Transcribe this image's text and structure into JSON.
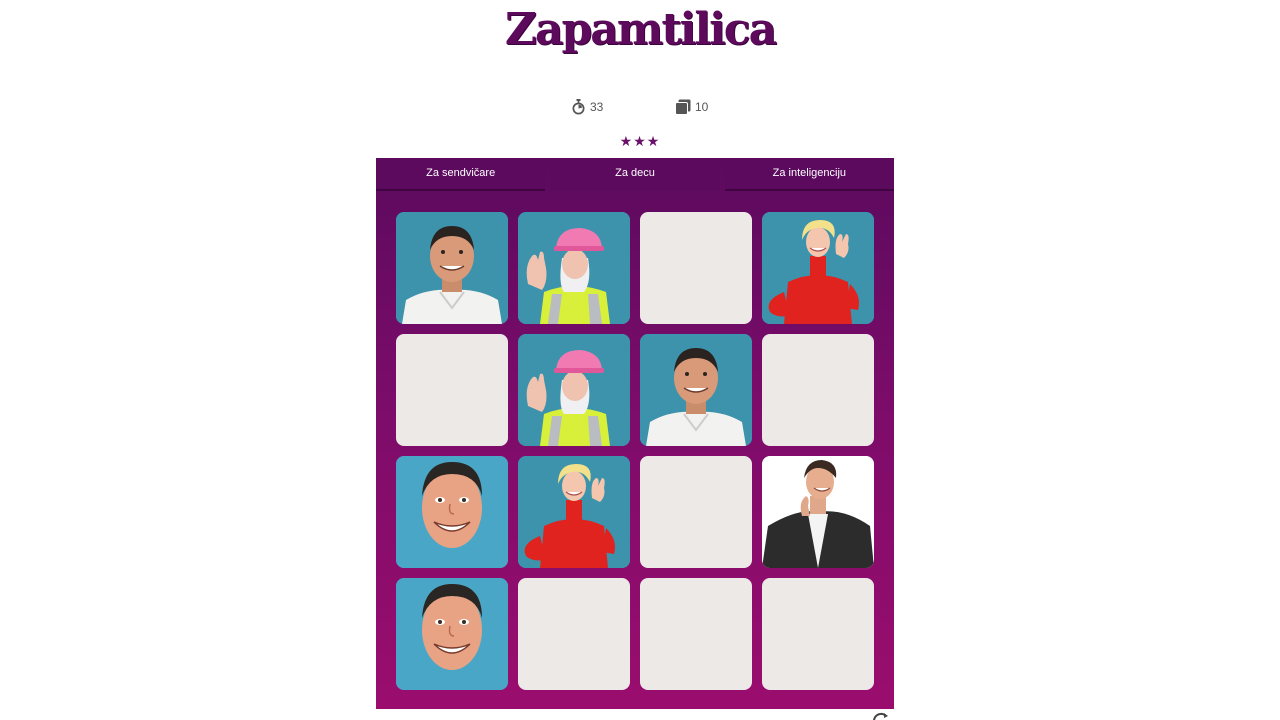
{
  "app": {
    "logo_text": "Zapamtilica"
  },
  "stats": {
    "timer_icon": "stopwatch-icon",
    "timer_value": "33",
    "moves_icon": "cards-icon",
    "moves_value": "10"
  },
  "rating": {
    "stars": "★★★",
    "stars_count": 3
  },
  "tabs": [
    {
      "label": "Za sendvičare",
      "active": false
    },
    {
      "label": "Za decu",
      "active": true
    },
    {
      "label": "Za inteligenciju",
      "active": false
    }
  ],
  "cards": [
    {
      "state": "face-up",
      "face": "man-white-polo"
    },
    {
      "state": "face-up",
      "face": "woman-pink-helmet"
    },
    {
      "state": "face-down",
      "face": ""
    },
    {
      "state": "face-up",
      "face": "woman-red-top"
    },
    {
      "state": "face-down",
      "face": ""
    },
    {
      "state": "face-up",
      "face": "woman-pink-helmet"
    },
    {
      "state": "face-up",
      "face": "man-white-polo"
    },
    {
      "state": "face-down",
      "face": ""
    },
    {
      "state": "face-up",
      "face": "man-smiling-face"
    },
    {
      "state": "face-up",
      "face": "woman-red-top"
    },
    {
      "state": "face-down",
      "face": ""
    },
    {
      "state": "face-up",
      "face": "man-dark-suit"
    },
    {
      "state": "face-up",
      "face": "man-smiling-face"
    },
    {
      "state": "face-down",
      "face": ""
    },
    {
      "state": "face-down",
      "face": ""
    },
    {
      "state": "face-down",
      "face": ""
    }
  ],
  "colors": {
    "brand": "#5d0a5d",
    "board_top": "#5b0a5e",
    "board_bottom": "#9a0d6e",
    "card_back": "#ece9e6",
    "card_face_bg": "#4aa9c8"
  },
  "footer": {
    "refresh_icon": "refresh-icon"
  }
}
